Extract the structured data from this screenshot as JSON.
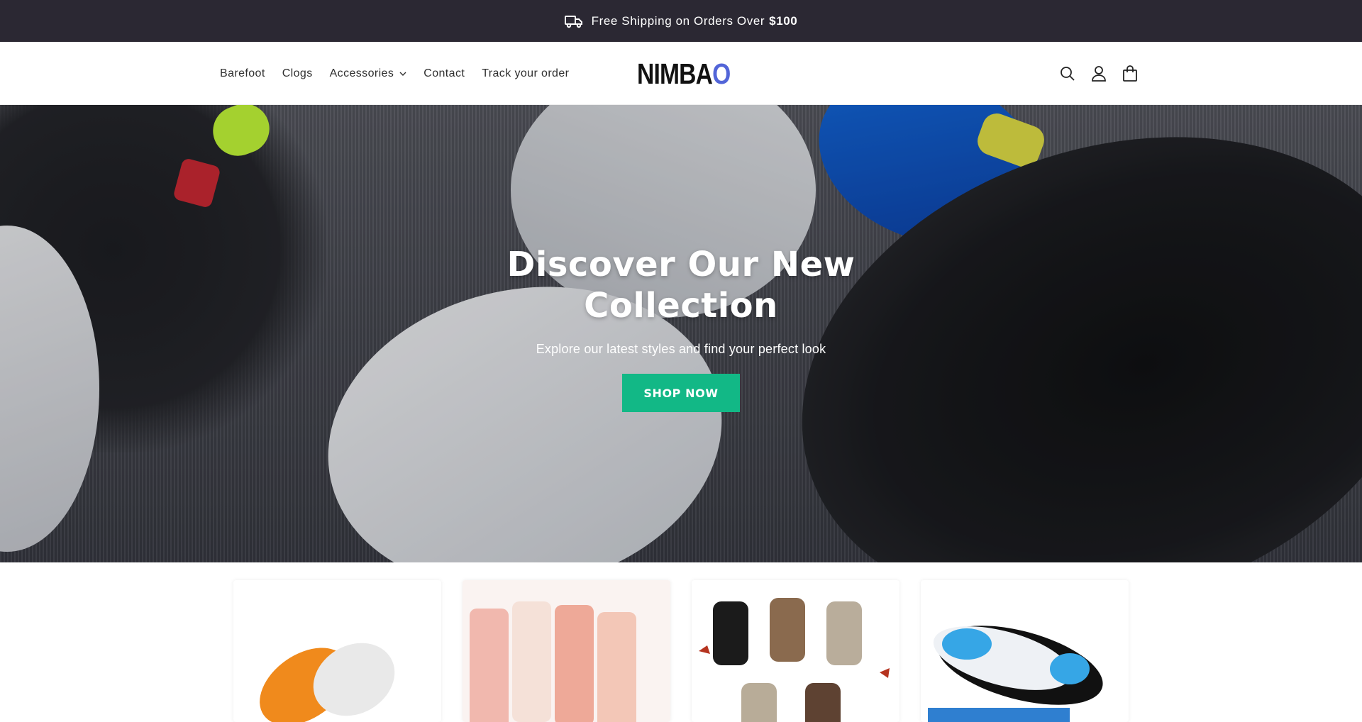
{
  "announcement": {
    "text": "Free Shipping on Orders Over",
    "amount": "$100",
    "icon": "truck-icon"
  },
  "header": {
    "logo_main": "NIMBA",
    "logo_accent": "O",
    "logo_accent_color": "#5265d8",
    "nav": [
      {
        "label": "Barefoot"
      },
      {
        "label": "Clogs"
      },
      {
        "label": "Accessories",
        "has_dropdown": true
      },
      {
        "label": "Contact"
      },
      {
        "label": "Track your order"
      }
    ],
    "icons": [
      "search-icon",
      "account-icon",
      "cart-icon"
    ]
  },
  "hero": {
    "title": "Discover Our New Collection",
    "subtitle": "Explore our latest styles and find your perfect look",
    "button_label": "SHOP NOW",
    "button_color": "#12b886"
  },
  "products": [
    {
      "image": "barefoot-shoes"
    },
    {
      "image": "pink-socks"
    },
    {
      "image": "ankle-socks"
    },
    {
      "image": "insoles"
    }
  ]
}
